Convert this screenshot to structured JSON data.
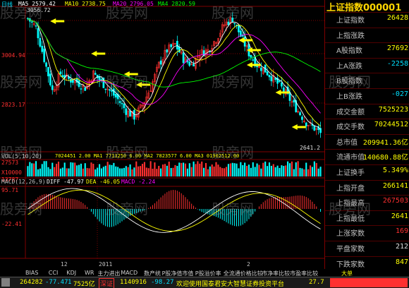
{
  "header": {
    "period": "日线",
    "ma_labels": [
      {
        "text": "MA5 2579.42",
        "color": "#ffffff"
      },
      {
        "text": "MA10 2738.75",
        "color": "#ffff00"
      },
      {
        "text": "MA20 2796.05",
        "color": "#ff00ff"
      },
      {
        "text": "MA4 2820.59",
        "color": "#00ff00"
      }
    ],
    "high_label": "3056.72"
  },
  "price_axis": {
    "labels": [
      "3004.94",
      "2823.17"
    ]
  },
  "low_price_label": "2641.2",
  "volume_panel": {
    "header": "VOL(5,10,20)",
    "values_text": "7024451 2.00  MA1 7713250 6.00  MA2 7823577 6.00  MA3 01902512.00",
    "axis": [
      "27573",
      "13787",
      "X10000"
    ]
  },
  "macd_panel": {
    "header": "MACD(12,26,9)",
    "diff": "DIFF -47.97",
    "dea": "DEA -46.05",
    "macd": "MACD -2.24",
    "axis": [
      "95.71",
      "-22.41"
    ]
  },
  "time_axis": {
    "labels": [
      "12",
      "2011",
      "2"
    ]
  },
  "right_panel": {
    "title": "上证指数000001",
    "rows": [
      {
        "label": "上证指数",
        "value": "26428",
        "color": "yellow"
      },
      {
        "label": "上指涨跌",
        "value": "",
        "color": "red"
      },
      {
        "label": "A股指数",
        "value": "27692",
        "color": "yellow"
      },
      {
        "label": "上A涨跌",
        "value": "-2258",
        "color": "cyan"
      },
      {
        "label": "B股指数",
        "value": "",
        "color": "yellow"
      },
      {
        "label": "上B涨跌",
        "value": "-027",
        "color": "cyan"
      },
      {
        "label": "成交金额",
        "value": "7525223",
        "color": "yellow"
      },
      {
        "label": "成交手数",
        "value": "70244512",
        "color": "yellow"
      },
      {
        "label": "总市值",
        "value": "209941.36亿",
        "color": "yellow"
      },
      {
        "label": "流通市值",
        "value": "140680.88亿",
        "color": "yellow"
      },
      {
        "label": "上证换手",
        "value": "5.349%",
        "color": "yellow"
      },
      {
        "label": "上指开盘",
        "value": "266141",
        "color": "yellow"
      },
      {
        "label": "上指最高",
        "value": "267503",
        "color": "red"
      },
      {
        "label": "上指最低",
        "value": "2641",
        "color": "yellow"
      },
      {
        "label": "上涨家数",
        "value": "169",
        "color": "red"
      },
      {
        "label": "平盘家数",
        "value": "212",
        "color": "white"
      },
      {
        "label": "下跌家数",
        "value": "847",
        "color": "yellow"
      }
    ]
  },
  "indicator_tabs": [
    "BIAS",
    "CCI",
    "KDJ",
    "WR",
    "主力进出",
    "MACD",
    "数产统",
    "P股净值市值",
    "P股溢价率",
    "全流通价格比较",
    "市净率比较",
    "市盈率比较"
  ],
  "bottom_right_label": "大单",
  "status_bar": {
    "index_value": "264282",
    "change": "-77.47",
    "small_val": "1",
    "volume": "7525亿",
    "exchange_label": "深证",
    "sz_value": "1140916",
    "sz_change": "-98.27",
    "ticker": "欢迎使用国泰君安大智慧证券投资平台",
    "right_value": "27.7"
  },
  "watermark": "股旁网",
  "colors": {
    "up": "#ff3030",
    "down": "#00ffff",
    "ma5": "#ffffff",
    "ma10": "#ffff00",
    "ma20": "#ff00ff",
    "ma60": "#00ff00",
    "grid": "#800000",
    "arrow": "#ffff00"
  }
}
